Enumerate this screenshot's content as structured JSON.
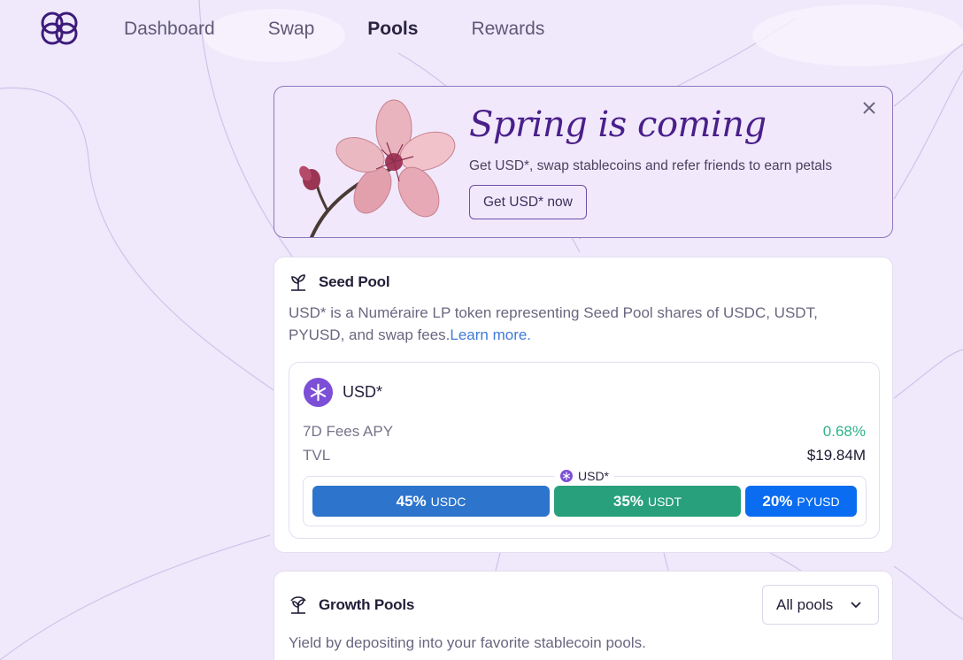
{
  "nav": {
    "items": [
      {
        "label": "Dashboard",
        "active": false
      },
      {
        "label": "Swap",
        "active": false
      },
      {
        "label": "Pools",
        "active": true
      },
      {
        "label": "Rewards",
        "active": false
      }
    ]
  },
  "banner": {
    "title": "Spring is coming",
    "subtitle": "Get USD*, swap stablecoins and refer friends to earn petals",
    "button_label": "Get USD* now"
  },
  "seed_pool": {
    "title": "Seed Pool",
    "description": "USD* is a Numéraire LP token representing Seed Pool shares of USDC, USDT, PYUSD, and swap fees.",
    "learn_more": "Learn more.",
    "token": {
      "name": "USD*",
      "apy_label": "7D Fees APY",
      "apy_value": "0.68%",
      "tvl_label": "TVL",
      "tvl_value": "$19.84M"
    },
    "composition": {
      "legend": "USD*",
      "segments": [
        {
          "pct": "45%",
          "symbol": "USDC",
          "fraction": 0.45,
          "color": "#2d74cc"
        },
        {
          "pct": "35%",
          "symbol": "USDT",
          "fraction": 0.35,
          "color": "#28a07c"
        },
        {
          "pct": "20%",
          "symbol": "PYUSD",
          "fraction": 0.2,
          "color": "#0a6cf0"
        }
      ]
    }
  },
  "growth_pools": {
    "title": "Growth Pools",
    "description": "Yield by depositing into your favorite stablecoin pools.",
    "filter_value": "All pools"
  },
  "colors": {
    "brand": "#4a1f8a",
    "background": "#efe9fb",
    "link": "#3f7ad9",
    "positive": "#2fb28a"
  }
}
